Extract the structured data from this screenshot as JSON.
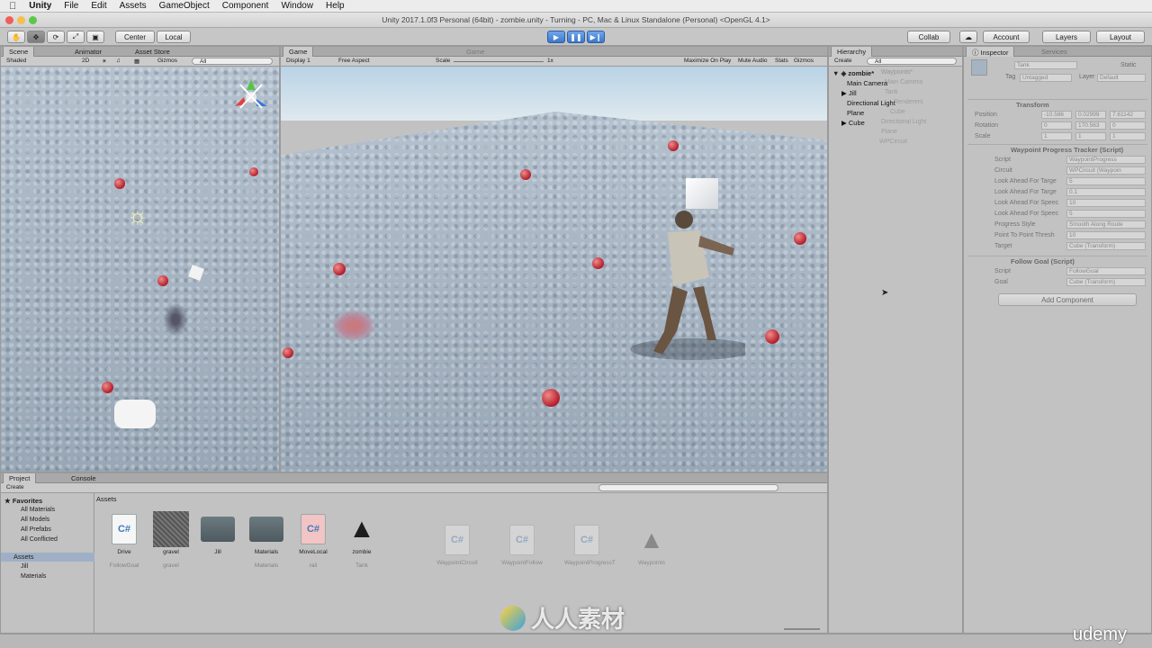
{
  "menubar": {
    "items": [
      "Unity",
      "File",
      "Edit",
      "Assets",
      "GameObject",
      "Component",
      "Window",
      "Help"
    ]
  },
  "window": {
    "title": "Unity 2017.1.0f3 Personal (64bit) - zombie.unity - Turning - PC, Mac & Linux Standalone (Personal) <OpenGL 4.1>"
  },
  "toolbar": {
    "pivot": "Center",
    "space": "Local",
    "collab": "Collab",
    "account": "Account",
    "layers": "Layers",
    "layout": "Layout"
  },
  "scene": {
    "tabs": [
      "Scene",
      "Animator",
      "Asset Store"
    ],
    "shading": "Shaded",
    "mode2d": "2D",
    "gizmos": "Gizmos",
    "search": "All"
  },
  "game": {
    "tab": "Game",
    "display": "Display 1",
    "aspect": "Free Aspect",
    "scale_label": "Scale",
    "scale_value": "1x",
    "toggles": [
      "Maximize On Play",
      "Mute Audio",
      "Stats",
      "Gizmos"
    ],
    "ghost_tab": "Game"
  },
  "hierarchy": {
    "tab": "Hierarchy",
    "create": "Create",
    "search": "All",
    "scene": "zombie*",
    "items": [
      "Main Camera",
      "Jill",
      "Directional Light",
      "Plane",
      "Cube"
    ],
    "ghost_items": [
      "Waypoints*",
      "Main Camera",
      "Tank",
      "Renderers",
      "Cube",
      "Directional Light",
      "Plane",
      "WPCircuit"
    ]
  },
  "inspector": {
    "tab": "Inspector",
    "ghost_tab": "Services",
    "object_name": "Tank",
    "static": "Static",
    "tag_label": "Tag",
    "tag_value": "Untagged",
    "layer_label": "Layer",
    "layer_value": "Default",
    "transform": {
      "title": "Transform",
      "position_label": "Position",
      "pos": [
        "-10.586",
        "0.02999",
        "7.61142"
      ],
      "rotation_label": "Rotation",
      "rot": [
        "0",
        "170.563",
        "0"
      ],
      "scale_label": "Scale",
      "scale": [
        "1",
        "1",
        "1"
      ]
    },
    "tracker": {
      "title": "Waypoint Progress Tracker (Script)",
      "script_label": "Script",
      "script_value": "WaypointProgress",
      "rows": [
        {
          "label": "Circuit",
          "value": "WPCircuit (Waypoin"
        },
        {
          "label": "Look Ahead For Targe",
          "value": "5"
        },
        {
          "label": "Look Ahead For Targe",
          "value": "0.1"
        },
        {
          "label": "Look Ahead For Speec",
          "value": "10"
        },
        {
          "label": "Look Ahead For Speec",
          "value": "5"
        },
        {
          "label": "Progress Style",
          "value": "Smooth Along Route"
        },
        {
          "label": "Point To Point Thresh",
          "value": "10"
        },
        {
          "label": "Target",
          "value": "Cube (Transform)"
        }
      ]
    },
    "follow": {
      "title": "Follow Goal (Script)",
      "script_label": "Script",
      "script_value": "FollowGoal",
      "goal_label": "Goal",
      "goal_value": "Cube (Transform)"
    },
    "add_component": "Add Component"
  },
  "project": {
    "tabs": [
      "Project",
      "Console"
    ],
    "create": "Create",
    "favorites_title": "Favorites",
    "favorites": [
      "All Materials",
      "All Models",
      "All Prefabs",
      "All Conflicted"
    ],
    "assets_root": "Assets",
    "tree": [
      "Jill",
      "Materials"
    ],
    "breadcrumb": "Assets",
    "assets": [
      {
        "name": "Drive",
        "ghost": "FollowGoal"
      },
      {
        "name": "gravel",
        "ghost": "gravel"
      },
      {
        "name": "Jill",
        "ghost": ""
      },
      {
        "name": "Materials",
        "ghost": "Materials"
      },
      {
        "name": "MoveLocal",
        "ghost": "rail"
      },
      {
        "name": "zombie",
        "ghost": "Tank"
      }
    ],
    "ghost_assets": [
      "WaypointCircuit",
      "WaypointFollow",
      "WaypointProgressT",
      "Waypoints"
    ]
  },
  "watermarks": {
    "brand": "人人素材",
    "udemy": "udemy"
  }
}
